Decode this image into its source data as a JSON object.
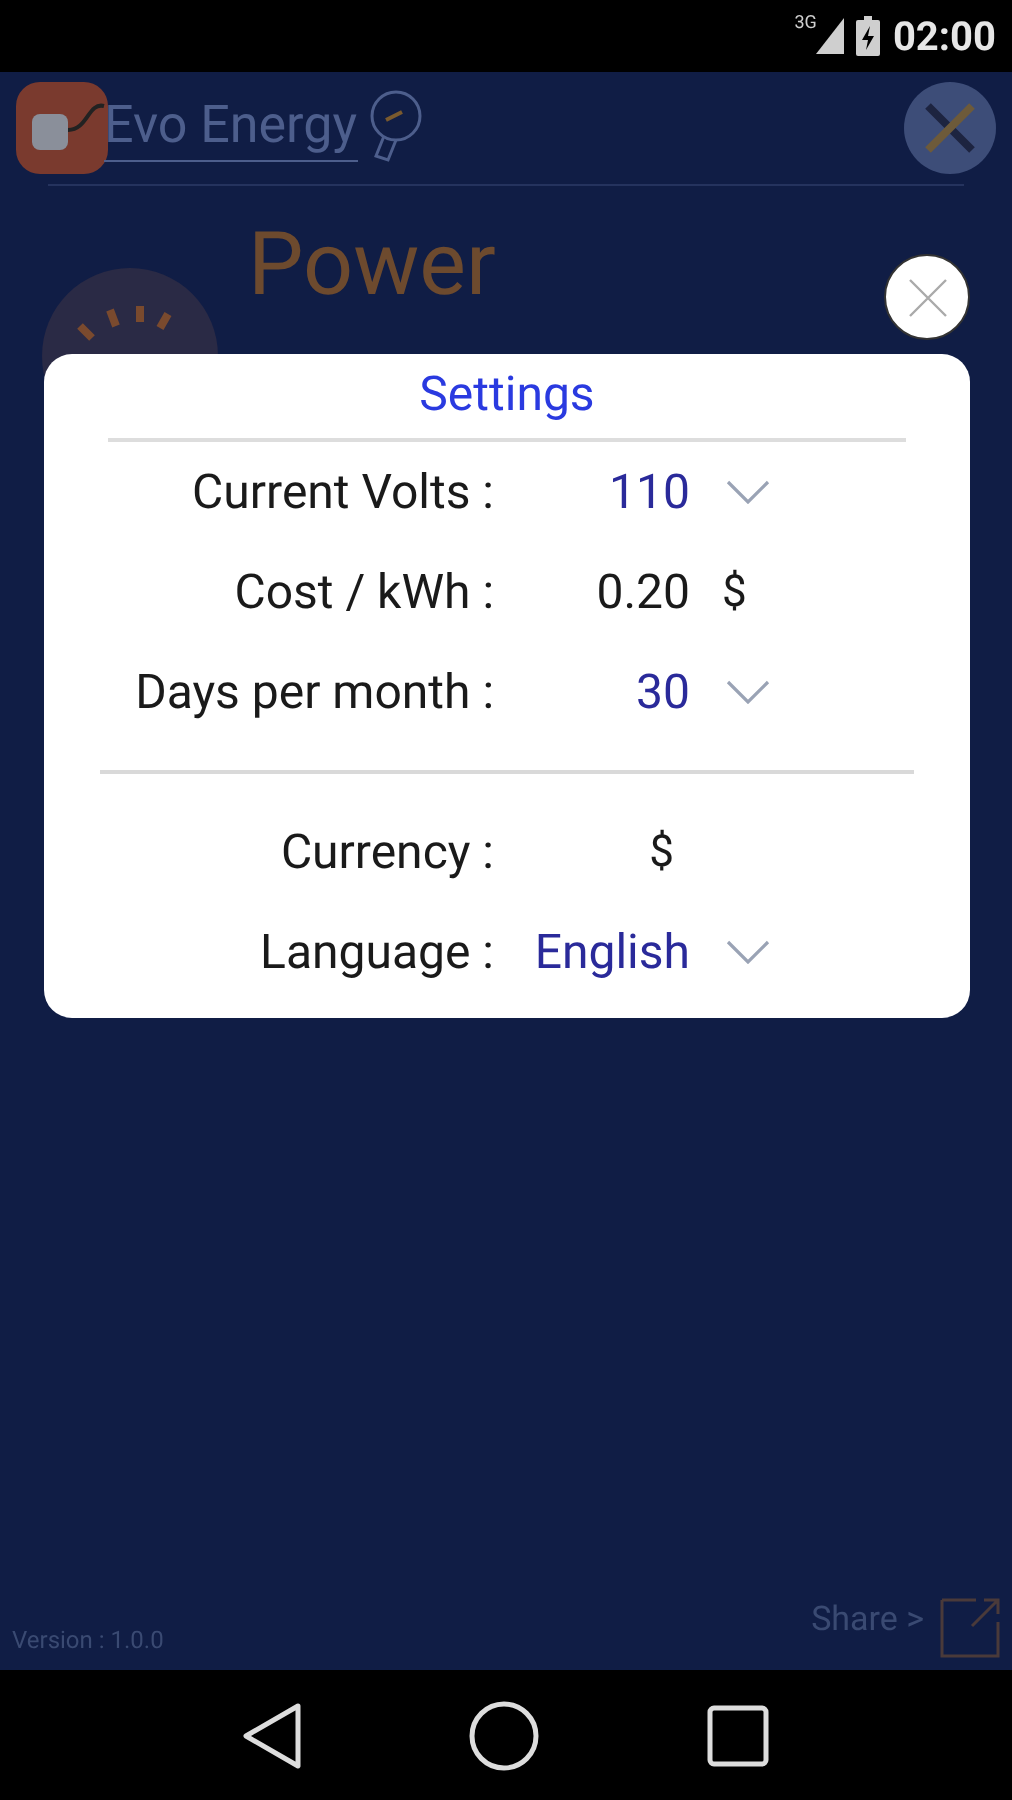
{
  "status_bar": {
    "network": "3G",
    "time": "02:00"
  },
  "header": {
    "app_name": "Evo Energy"
  },
  "heading": "Power",
  "settings_dialog": {
    "title": "Settings",
    "rows": [
      {
        "kind": "select",
        "label": "Current Volts :",
        "value": "110"
      },
      {
        "kind": "unit",
        "label": "Cost / kWh :",
        "value": "0.20",
        "unit": "$"
      },
      {
        "kind": "select",
        "label": "Days per month :",
        "value": "30"
      },
      {
        "kind": "divider"
      },
      {
        "kind": "plain",
        "label": "Currency :",
        "value": "$"
      },
      {
        "kind": "select",
        "label": "Language :",
        "value": "English"
      }
    ]
  },
  "footer": {
    "version": "Version : 1.0.0",
    "share": "Share >"
  }
}
